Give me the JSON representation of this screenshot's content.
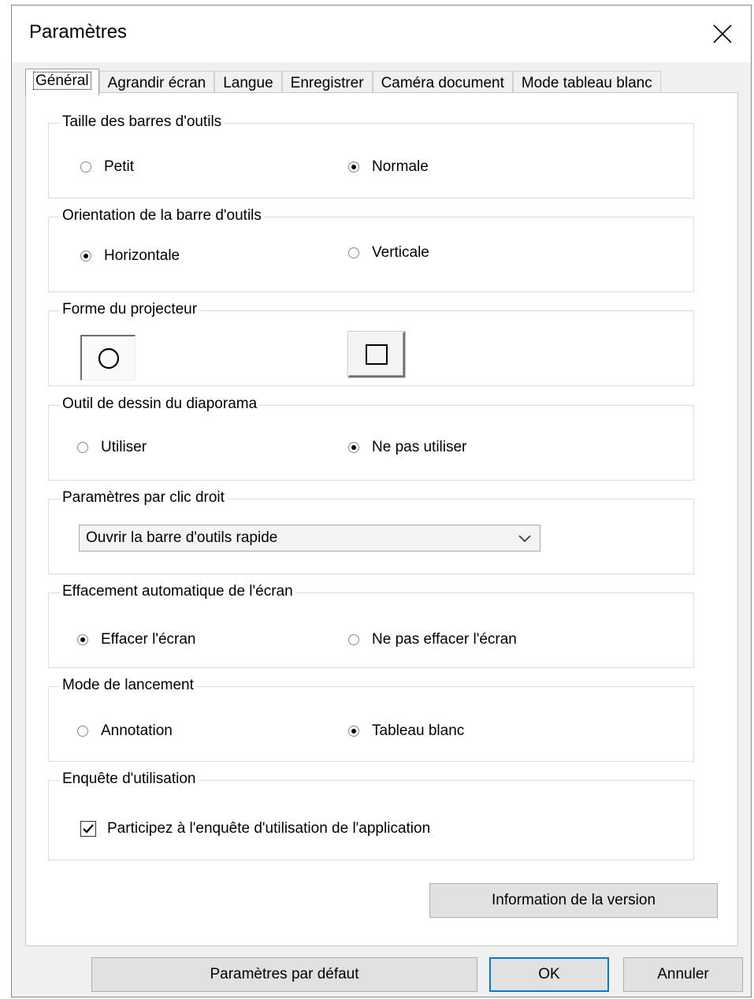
{
  "window": {
    "title": "Paramètres",
    "close_icon": "close-icon"
  },
  "tabs": [
    {
      "label": "Général",
      "active": true
    },
    {
      "label": "Agrandir écran"
    },
    {
      "label": "Langue"
    },
    {
      "label": "Enregistrer"
    },
    {
      "label": "Caméra document"
    },
    {
      "label": "Mode tableau blanc"
    }
  ],
  "toolbar_size": {
    "label": "Taille des barres d'outils",
    "options": [
      {
        "label": "Petit",
        "selected": false
      },
      {
        "label": "Normale",
        "selected": true
      }
    ]
  },
  "toolbar_orientation": {
    "label": "Orientation de la barre d'outils",
    "options": [
      {
        "label": "Horizontale",
        "selected": true
      },
      {
        "label": "Verticale",
        "selected": false
      }
    ]
  },
  "projector_shape": {
    "label": "Forme du projecteur",
    "options": [
      {
        "icon": "circle-icon",
        "selected": true
      },
      {
        "icon": "square-icon",
        "selected": false
      }
    ]
  },
  "slideshow_drawing": {
    "label": "Outil de dessin du diaporama",
    "options": [
      {
        "label": "Utiliser",
        "selected": false
      },
      {
        "label": "Ne pas utiliser",
        "selected": true
      }
    ]
  },
  "right_click": {
    "label": "Paramètres par clic droit",
    "selected_value": "Ouvrir la barre d'outils rapide"
  },
  "auto_erase": {
    "label": "Effacement automatique de l'écran",
    "options": [
      {
        "label": "Effacer l'écran",
        "selected": true
      },
      {
        "label": "Ne pas effacer l'écran",
        "selected": false
      }
    ]
  },
  "launch_mode": {
    "label": "Mode de lancement",
    "options": [
      {
        "label": "Annotation",
        "selected": false
      },
      {
        "label": "Tableau blanc",
        "selected": true
      }
    ]
  },
  "survey": {
    "label": "Enquête d'utilisation",
    "checkbox_label": "Participez à l'enquête d'utilisation de l'application",
    "checked": true
  },
  "version_button": "Information de la version",
  "footer": {
    "defaults_button": "Paramètres par défaut",
    "ok_button": "OK",
    "cancel_button": "Annuler"
  },
  "colors": {
    "accent": "#0078d7",
    "background": "#f0f0f0",
    "button": "#e1e1e1"
  }
}
